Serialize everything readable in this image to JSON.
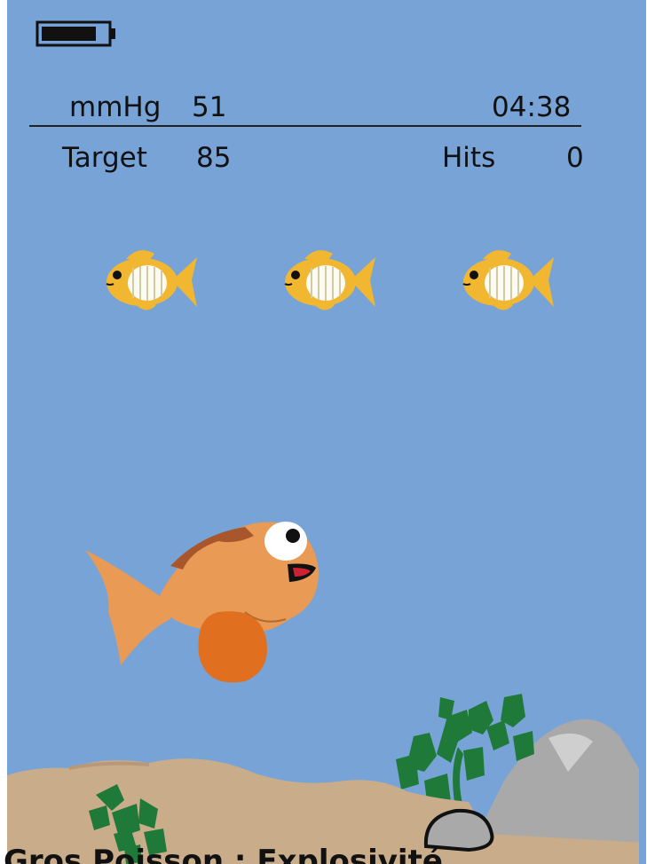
{
  "hud": {
    "pressure_unit": "mmHg",
    "pressure_value": "51",
    "timer": "04:38",
    "target_label": "Target",
    "target_value": "85",
    "hits_label": "Hits",
    "hits_value": "0"
  },
  "battery": {
    "level": 0.85
  },
  "targets": {
    "count": 3,
    "color": "#f2b731"
  },
  "player_fish": {
    "color": "#e99a55",
    "fin_color": "#e0701f"
  },
  "caption": {
    "text": "Gros Poisson : Explosivité"
  },
  "colors": {
    "water": "#78a3d6",
    "sand": "#c9ac8a",
    "seaweed": "#1f7a3a",
    "rock": "#a9a9a9"
  }
}
